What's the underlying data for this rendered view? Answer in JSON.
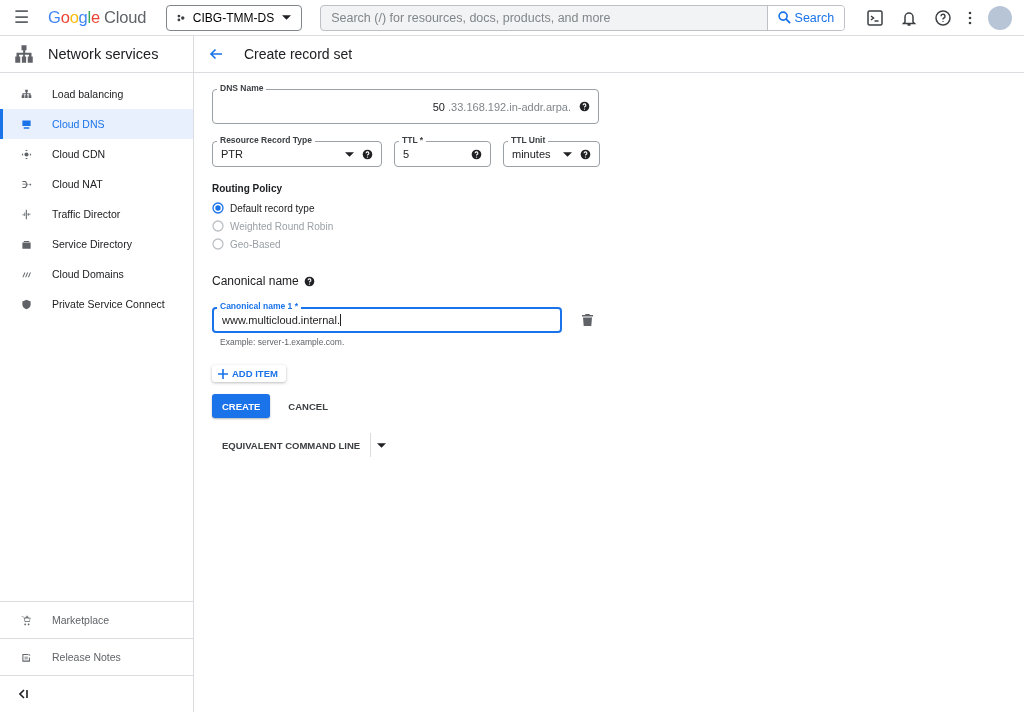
{
  "topbar": {
    "menu_glyph": "☰",
    "logo": {
      "brand": "Google",
      "product": "Cloud"
    },
    "project": "CIBG-TMM-DS",
    "search": {
      "placeholder": "Search (/) for resources, docs, products, and more",
      "button": "Search"
    }
  },
  "sidebar": {
    "title": "Network services",
    "items": [
      {
        "label": "Load balancing",
        "selected": false
      },
      {
        "label": "Cloud DNS",
        "selected": true
      },
      {
        "label": "Cloud CDN",
        "selected": false
      },
      {
        "label": "Cloud NAT",
        "selected": false
      },
      {
        "label": "Traffic Director",
        "selected": false
      },
      {
        "label": "Service Directory",
        "selected": false
      },
      {
        "label": "Cloud Domains",
        "selected": false
      },
      {
        "label": "Private Service Connect",
        "selected": false
      }
    ],
    "footer_items": [
      "Marketplace",
      "Release Notes"
    ]
  },
  "page": {
    "title": "Create record set",
    "dns_name": {
      "label": "DNS Name",
      "value": "50",
      "suffix": ".33.168.192.in-addr.arpa."
    },
    "record_type": {
      "label": "Resource Record Type",
      "value": "PTR"
    },
    "ttl": {
      "label": "TTL *",
      "value": "5"
    },
    "ttl_unit": {
      "label": "TTL Unit",
      "value": "minutes"
    },
    "routing_policy": {
      "title": "Routing Policy",
      "options": [
        {
          "label": "Default record type",
          "selected": true,
          "disabled": false
        },
        {
          "label": "Weighted Round Robin",
          "selected": false,
          "disabled": true
        },
        {
          "label": "Geo-Based",
          "selected": false,
          "disabled": true
        }
      ]
    },
    "canonical": {
      "title": "Canonical name",
      "items": [
        {
          "label": "Canonical name 1 *",
          "value": "www.multicloud.internal.",
          "focused": true
        }
      ],
      "hint": "Example: server-1.example.com."
    },
    "add_item": "ADD ITEM",
    "create": "CREATE",
    "cancel": "CANCEL",
    "command_line": "EQUIVALENT COMMAND LINE"
  }
}
